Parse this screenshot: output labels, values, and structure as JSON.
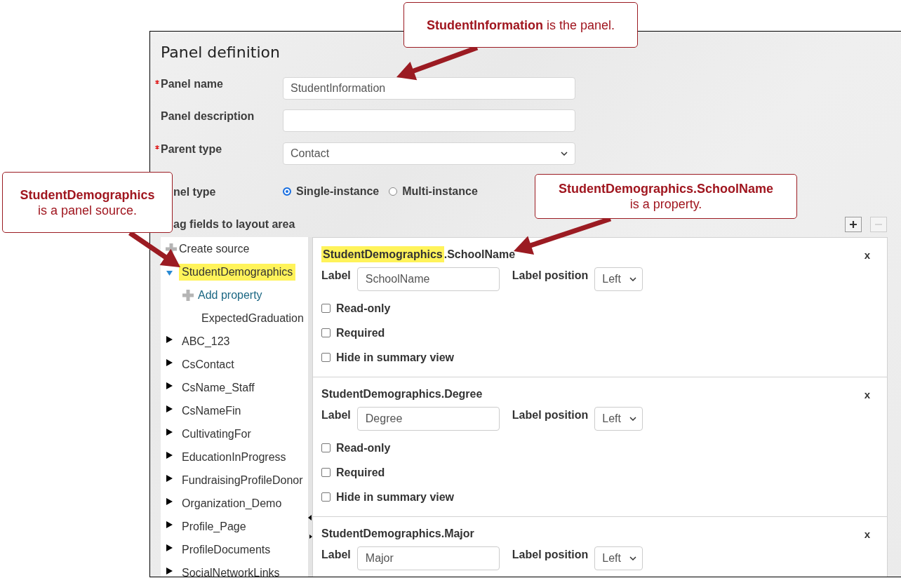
{
  "screen": {
    "title": "Panel definition",
    "fields": [
      {
        "kind": "text",
        "label": "Panel name",
        "required": true,
        "value": "StudentInformation"
      },
      {
        "kind": "text",
        "label": "Panel description",
        "required": false
      },
      {
        "kind": "select",
        "label": "Parent type",
        "required": true,
        "value": "Contact"
      }
    ],
    "panel_type": {
      "label": "nel type",
      "options": [
        {
          "label": "Single-instance",
          "selected": true
        },
        {
          "label": "Multi-instance",
          "selected": false
        }
      ]
    },
    "layout_label": "ag fields to layout area",
    "layout_buttons": [
      {
        "kind": "add",
        "disabled": false
      },
      {
        "kind": "remove",
        "disabled": true
      }
    ],
    "tree": [
      {
        "kind": "action",
        "label": "Create source"
      },
      {
        "kind": "source",
        "label": "StudentDemographics",
        "expanded": true,
        "highlighted": true,
        "children": [
          {
            "kind": "link",
            "label": "Add property"
          },
          {
            "kind": "property",
            "label": "ExpectedGraduation"
          }
        ]
      },
      {
        "kind": "source",
        "label": "ABC_123",
        "expanded": false,
        "highlighted": false
      },
      {
        "kind": "source",
        "label": "CsContact",
        "expanded": false,
        "highlighted": false
      },
      {
        "kind": "source",
        "label": "CsName_Staff",
        "expanded": false,
        "highlighted": false
      },
      {
        "kind": "source",
        "label": "CsNameFin",
        "expanded": false,
        "highlighted": false
      },
      {
        "kind": "source",
        "label": "CultivatingFor",
        "expanded": false,
        "highlighted": false
      },
      {
        "kind": "source",
        "label": "EducationInProgress",
        "expanded": false,
        "highlighted": false
      },
      {
        "kind": "source",
        "label": "FundraisingProfileDonor",
        "expanded": false,
        "highlighted": false
      },
      {
        "kind": "source",
        "label": "Organization_Demo",
        "expanded": false,
        "highlighted": false
      },
      {
        "kind": "source",
        "label": "Profile_Page",
        "expanded": false,
        "highlighted": false
      },
      {
        "kind": "source",
        "label": "ProfileDocuments",
        "expanded": false,
        "highlighted": false
      },
      {
        "kind": "source",
        "label": "SocialNetworkLinks",
        "expanded": false,
        "highlighted": false
      }
    ],
    "cards": [
      {
        "title": [
          {
            "text": "StudentDemographics",
            "highlighted": true
          },
          {
            "text": ".SchoolName",
            "highlighted": false
          }
        ],
        "close": "x",
        "label_caption": "Label",
        "label_value": "SchoolName",
        "position_caption": "Label position",
        "position_value": "Left",
        "checkboxes": [
          {
            "label": "Read-only",
            "checked": false
          },
          {
            "label": "Required",
            "checked": false
          },
          {
            "label": "Hide in summary view",
            "checked": false
          }
        ]
      },
      {
        "title": [
          {
            "text": "StudentDemographics.Degree",
            "highlighted": false
          }
        ],
        "close": "x",
        "label_caption": "Label",
        "label_value": "Degree",
        "position_caption": "Label position",
        "position_value": "Left",
        "checkboxes": [
          {
            "label": "Read-only",
            "checked": false
          },
          {
            "label": "Required",
            "checked": false
          },
          {
            "label": "Hide in summary view",
            "checked": false
          }
        ]
      },
      {
        "title": [
          {
            "text": "StudentDemographics.Major",
            "highlighted": false
          }
        ],
        "close": "x",
        "label_caption": "Label",
        "label_value": "Major",
        "position_caption": "Label position",
        "position_value": "Left"
      }
    ]
  },
  "callouts": [
    {
      "text": "**StudentInformation** is the panel."
    },
    {
      "text": "**StudentDemographics**\nis a panel source."
    },
    {
      "text": "**StudentDemographics.SchoolName**\nis a property."
    }
  ]
}
